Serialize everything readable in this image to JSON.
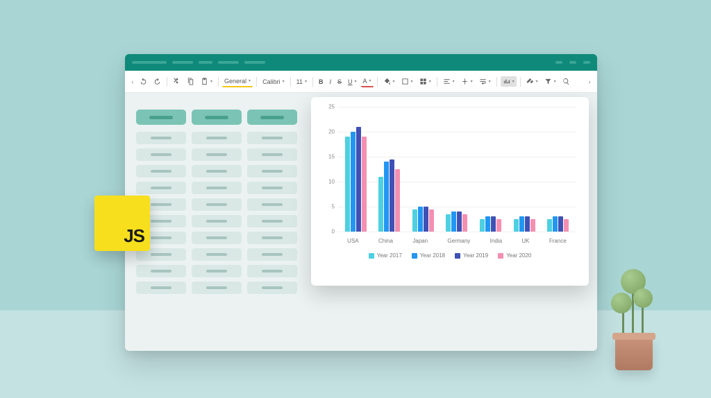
{
  "titlebar": {
    "pills": 5
  },
  "ribbon": {
    "numberFormat": "General",
    "fontName": "Calibri",
    "fontSize": "11",
    "bold": "B",
    "italic": "I",
    "strike": "S",
    "underline": "U",
    "fontColor": "A"
  },
  "spreadsheet": {
    "columns": 3,
    "rows": 10
  },
  "js_badge": "JS",
  "chart_data": {
    "type": "bar",
    "categories": [
      "USA",
      "China",
      "Japan",
      "Germany",
      "India",
      "UK",
      "France"
    ],
    "series": [
      {
        "name": "Year 2017",
        "color": "#4dd0e1",
        "values": [
          19,
          11,
          4.5,
          3.5,
          2.5,
          2.5,
          2.5
        ]
      },
      {
        "name": "Year 2018",
        "color": "#2196f3",
        "values": [
          20,
          14,
          5,
          4,
          3,
          3,
          3
        ]
      },
      {
        "name": "Year 2019",
        "color": "#3f51b5",
        "values": [
          21,
          14.5,
          5,
          4,
          3,
          3,
          3
        ]
      },
      {
        "name": "Year 2020",
        "color": "#f48fb1",
        "values": [
          19,
          12.5,
          4.5,
          3.5,
          2.5,
          2.5,
          2.5
        ]
      }
    ],
    "y_ticks": [
      0,
      5,
      10,
      15,
      20,
      25
    ],
    "ylim": [
      0,
      25
    ],
    "title": "",
    "xlabel": "",
    "ylabel": ""
  }
}
